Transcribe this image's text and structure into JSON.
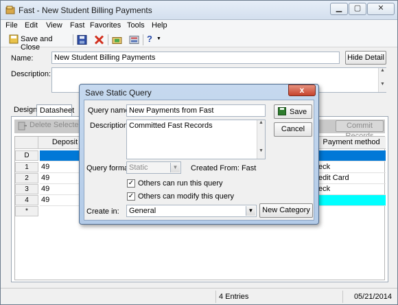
{
  "window": {
    "title": "Fast - New Student Billing Payments"
  },
  "menu": [
    "File",
    "Edit",
    "View",
    "Fast",
    "Favorites",
    "Tools",
    "Help"
  ],
  "toolbar": {
    "save_close_label": "Save and Close",
    "help_label": "?"
  },
  "form": {
    "name_label": "Name:",
    "name_value": "New Student Billing Payments",
    "hide_detail_label": "Hide Detail",
    "description_label": "Description:",
    "description_value": ""
  },
  "tabs": [
    "Design",
    "Datasheet"
  ],
  "grid_toolbar": {
    "delete_selected_label": "Delete Selected R",
    "commit_records_label": "Commit Records"
  },
  "grid": {
    "columns": [
      "Deposit",
      "Payment method"
    ],
    "rows": [
      {
        "header": "D",
        "deposit": "",
        "payment": ""
      },
      {
        "header": "1",
        "deposit": "49",
        "payment": "eck"
      },
      {
        "header": "2",
        "deposit": "49",
        "payment": "edit Card"
      },
      {
        "header": "3",
        "deposit": "49",
        "payment": "eck"
      },
      {
        "header": "4",
        "deposit": "49",
        "payment": ""
      },
      {
        "header": "*",
        "deposit": "",
        "payment": ""
      }
    ]
  },
  "status": {
    "entries": "4 Entries",
    "date": "05/21/2014"
  },
  "dialog": {
    "title": "Save Static Query",
    "close_icon_label": "x",
    "query_name_label": "Query name:",
    "query_name_value": "New Payments from Fast",
    "description_label": "Description:",
    "description_value": "Committed Fast Records",
    "query_format_label": "Query format:",
    "query_format_value": "Static",
    "created_from_label": "Created From: Fast",
    "others_run_label": "Others can run this query",
    "others_modify_label": "Others can modify this query",
    "create_in_label": "Create in:",
    "create_in_value": "General",
    "save_label": "Save",
    "cancel_label": "Cancel",
    "new_category_label": "New Category"
  },
  "colors": {
    "selected_row": "#0078d7",
    "highlight_row": "#00ffff",
    "dialog_frame": "#b3cbe8",
    "close_button": "#c6432c"
  }
}
